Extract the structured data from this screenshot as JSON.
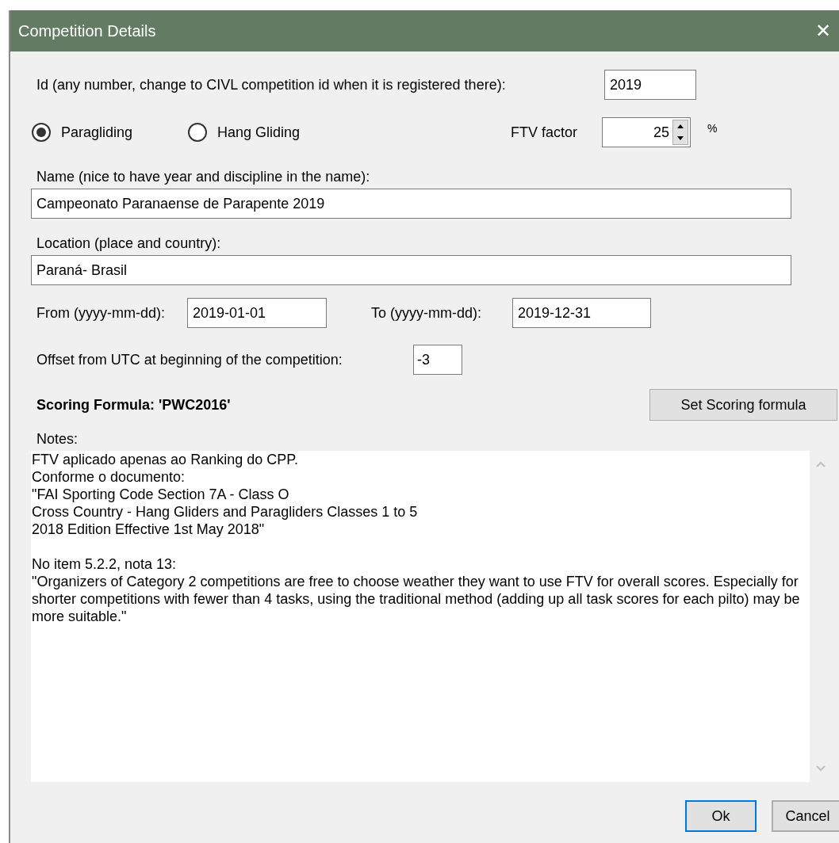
{
  "window": {
    "title": "Competition Details",
    "close": "✕"
  },
  "id_field": {
    "label": "Id (any number, change to CIVL competition id when it is registered there):",
    "value": "2019"
  },
  "discipline": [
    {
      "label": "Paragliding",
      "selected": true
    },
    {
      "label": "Hang Gliding",
      "selected": false
    }
  ],
  "ftv": {
    "label": "FTV factor",
    "value": "25",
    "unit": "%"
  },
  "name_field": {
    "label": "Name (nice to have year and discipline in the name):",
    "value": "Campeonato Paranaense de Parapente 2019"
  },
  "location_field": {
    "label": "Location (place and country):",
    "value": "Paraná- Brasil"
  },
  "from_field": {
    "label": "From (yyyy-mm-dd):",
    "value": "2019-01-01"
  },
  "to_field": {
    "label": "To (yyyy-mm-dd):",
    "value": "2019-12-31"
  },
  "offset_field": {
    "label": "Offset from UTC at beginning of the competition:",
    "value": "-3"
  },
  "scoring": {
    "label": "Scoring Formula: 'PWC2016'",
    "button": "Set Scoring formula"
  },
  "notes": {
    "label": "Notes:",
    "value": "FTV aplicado apenas ao Ranking do CPP.\nConforme o documento:\n\"FAI Sporting Code Section 7A - Class O\nCross Country - Hang Gliders and Paragliders Classes 1 to 5\n2018 Edition Effective 1st May 2018\"\n\nNo item 5.2.2, nota 13:\n\"Organizers of Category 2 competitions are free to choose weather they want to use FTV for overall scores. Especially for shorter competitions with fewer than 4 tasks, using the traditional method (adding up all task scores for each pilto) may be more suitable.\""
  },
  "buttons": [
    {
      "label": "Ok",
      "selected": true
    },
    {
      "label": "Cancel",
      "selected": false
    }
  ]
}
